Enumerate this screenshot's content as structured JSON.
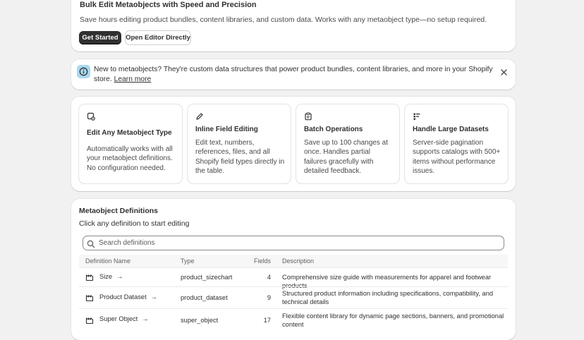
{
  "hero": {
    "title": "Bulk Edit Metaobjects with Speed and Precision",
    "subtitle": "Save hours editing product bundles, content libraries, and custom data. Works with any metaobject type—no setup required.",
    "primary_button": "Get Started",
    "secondary_button": "Open Editor Directly"
  },
  "banner": {
    "icon": "info-icon",
    "text": "New to metaobjects? They're custom data structures that power product bundles, content libraries, and more in your Shopify store. ",
    "link": "Learn more",
    "close_icon": "close-icon"
  },
  "features": [
    {
      "icon": "metaobject-type-icon",
      "title": "Edit Any Metaobject Type",
      "description": "Automatically works with all your metaobject definitions. No configuration needed."
    },
    {
      "icon": "edit-pencil-icon",
      "title": "Inline Field Editing",
      "description": "Edit text, numbers, references, files, and all Shopify field types directly in the table."
    },
    {
      "icon": "clipboard-icon",
      "title": "Batch Operations",
      "description": "Save up to 100 changes at once. Handles partial failures gracefully with detailed feedback."
    },
    {
      "icon": "large-dataset-icon",
      "title": "Handle Large Datasets",
      "description": "Server-side pagination supports catalogs with 500+ items without performance issues."
    }
  ],
  "definitions": {
    "title": "Metaobject Definitions",
    "subtitle": "Click any definition to start editing",
    "search_placeholder": "Search definitions",
    "columns": {
      "name": "Definition Name",
      "type": "Type",
      "fields": "Fields",
      "description": "Description"
    },
    "rows": [
      {
        "name": "Size",
        "type": "product_sizechart",
        "fields": "4",
        "description": "Comprehensive size guide with measurements for apparel and footwear products"
      },
      {
        "name": "Product Dataset",
        "type": "product_dataset",
        "fields": "9",
        "description": "Structured product information including specifications, compatibility, and technical details"
      },
      {
        "name": "Super Object",
        "type": "super_object",
        "fields": "17",
        "description": "Flexible content library for dynamic page sections, banners, and promotional content"
      }
    ]
  },
  "colors": {
    "primary_button": "#303030",
    "banner_icon_bg": "#a9d8ef",
    "page_bg": "#f1f1f1"
  }
}
